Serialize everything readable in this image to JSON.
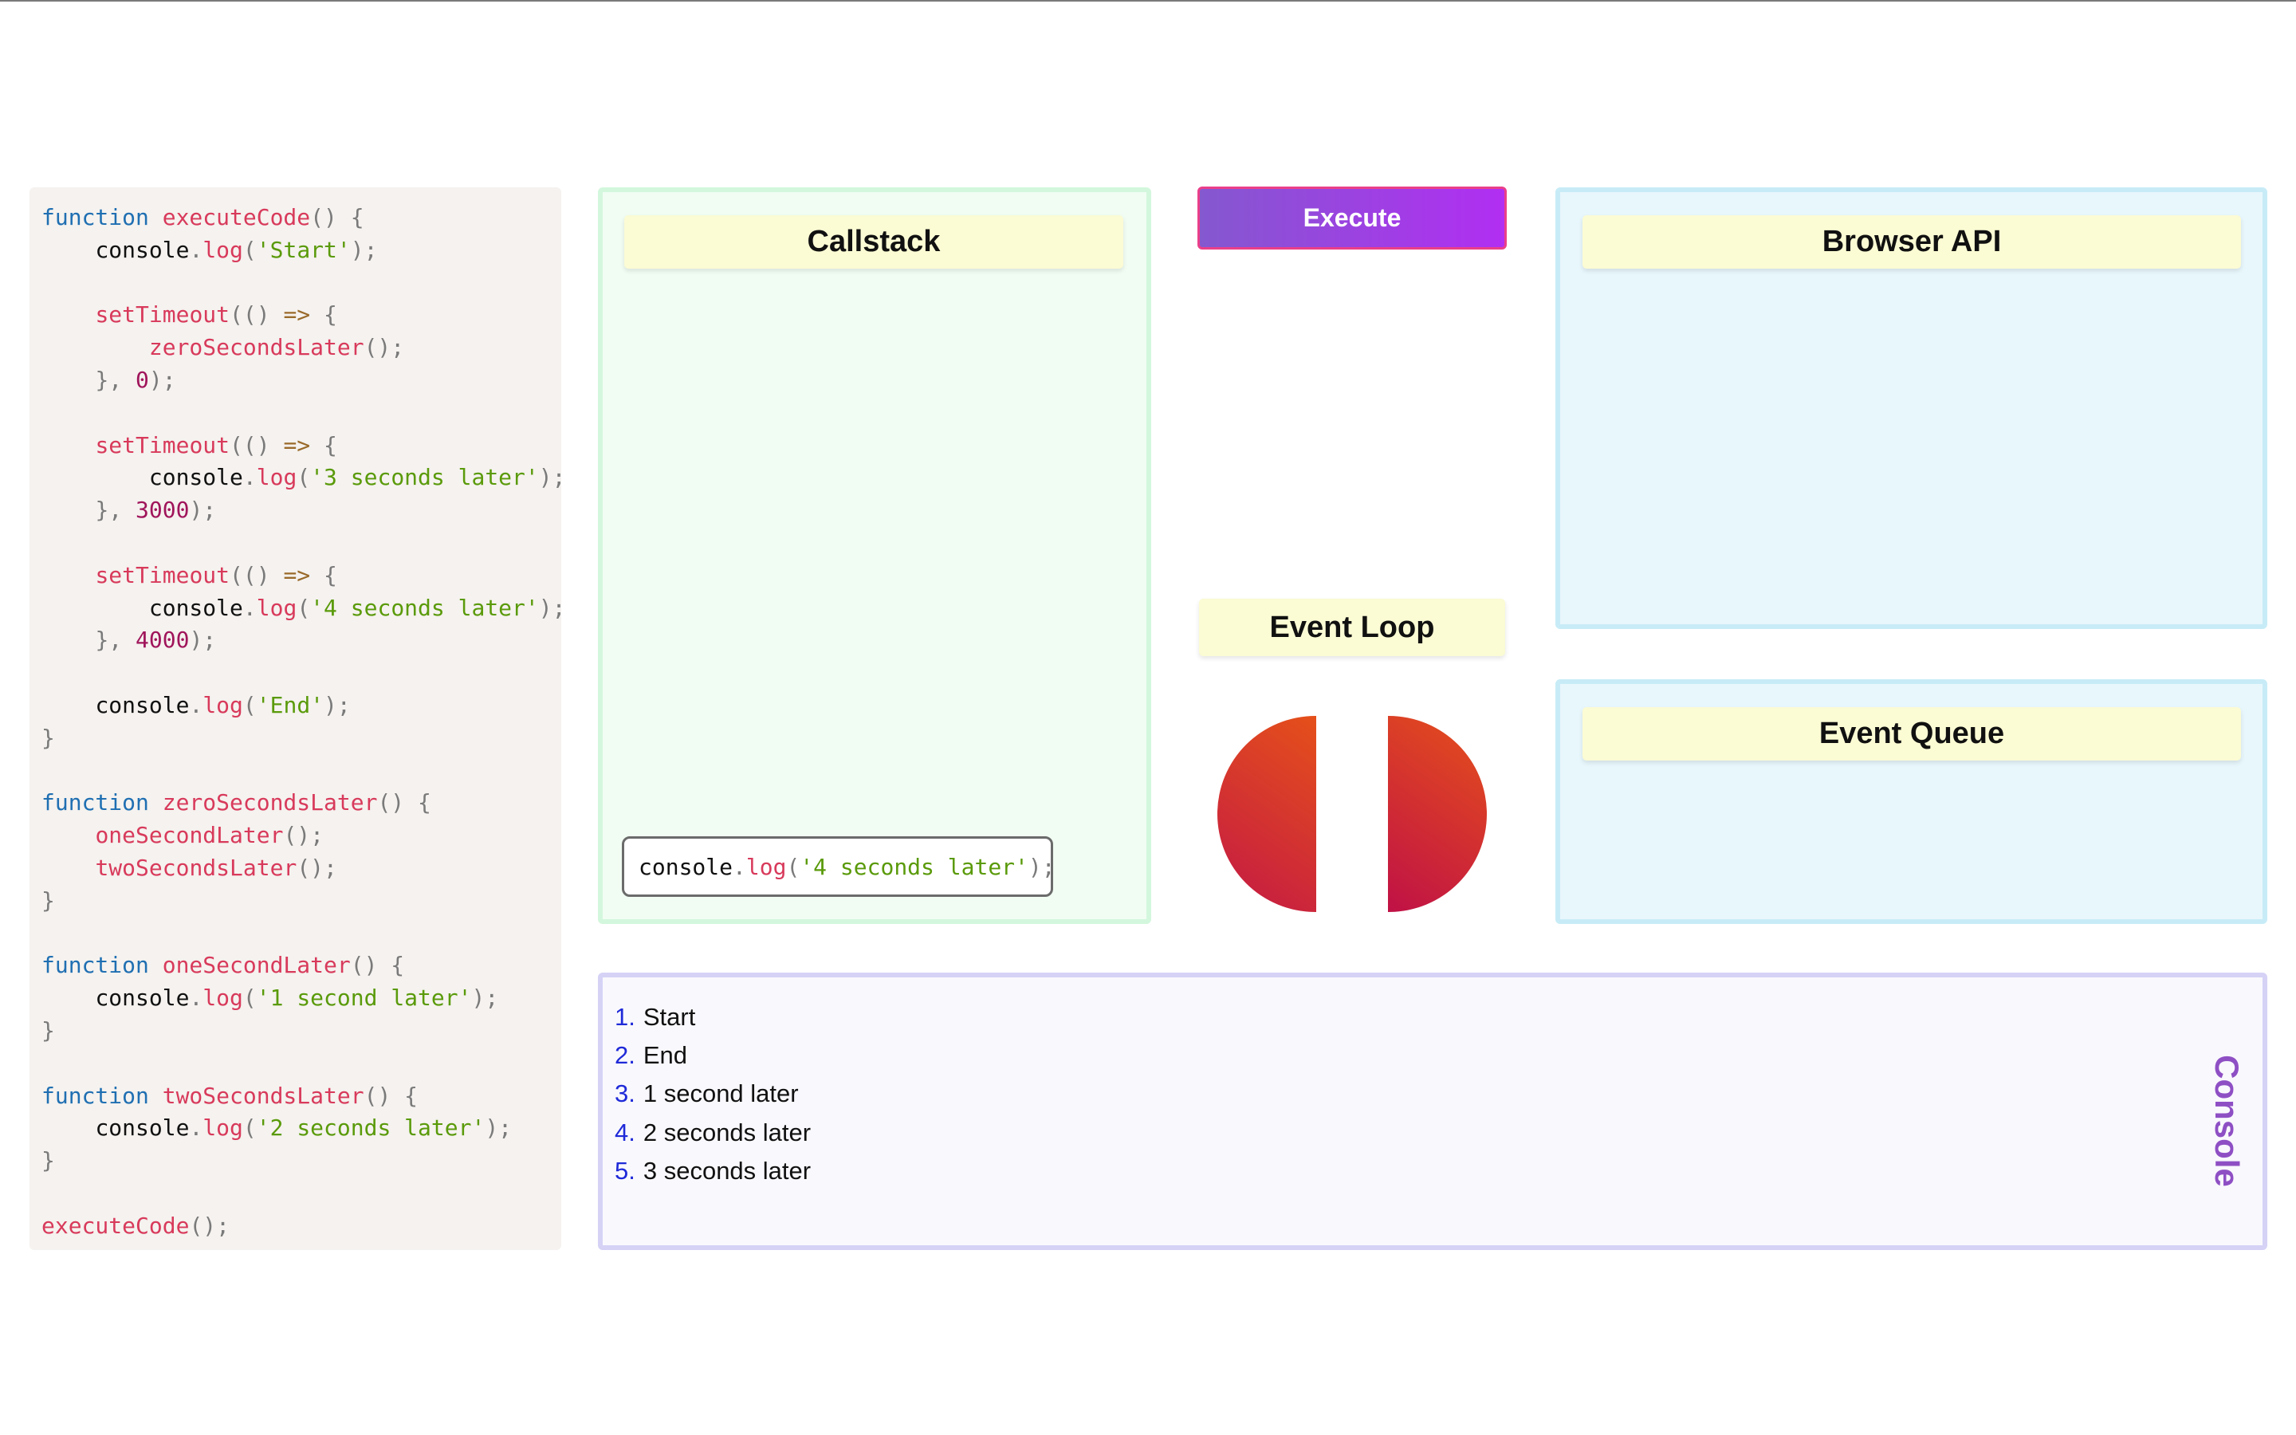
{
  "code_lines": [
    [
      {
        "t": "function",
        "c": "kw"
      },
      {
        "t": " "
      },
      {
        "t": "executeCode",
        "c": "fn"
      },
      {
        "t": "() {",
        "c": "pn"
      }
    ],
    [
      {
        "t": "    "
      },
      {
        "t": "console",
        "c": "id"
      },
      {
        "t": ".",
        "c": "pn"
      },
      {
        "t": "log",
        "c": "fn"
      },
      {
        "t": "(",
        "c": "pn"
      },
      {
        "t": "'Start'",
        "c": "str"
      },
      {
        "t": ");",
        "c": "pn"
      }
    ],
    [],
    [
      {
        "t": "    "
      },
      {
        "t": "setTimeout",
        "c": "fn"
      },
      {
        "t": "(() ",
        "c": "pn"
      },
      {
        "t": "=>",
        "c": "op"
      },
      {
        "t": " {",
        "c": "pn"
      }
    ],
    [
      {
        "t": "        "
      },
      {
        "t": "zeroSecondsLater",
        "c": "fn"
      },
      {
        "t": "();",
        "c": "pn"
      }
    ],
    [
      {
        "t": "    "
      },
      {
        "t": "}, ",
        "c": "pn"
      },
      {
        "t": "0",
        "c": "num"
      },
      {
        "t": ");",
        "c": "pn"
      }
    ],
    [],
    [
      {
        "t": "    "
      },
      {
        "t": "setTimeout",
        "c": "fn"
      },
      {
        "t": "(() ",
        "c": "pn"
      },
      {
        "t": "=>",
        "c": "op"
      },
      {
        "t": " {",
        "c": "pn"
      }
    ],
    [
      {
        "t": "        "
      },
      {
        "t": "console",
        "c": "id"
      },
      {
        "t": ".",
        "c": "pn"
      },
      {
        "t": "log",
        "c": "fn"
      },
      {
        "t": "(",
        "c": "pn"
      },
      {
        "t": "'3 seconds later'",
        "c": "str"
      },
      {
        "t": ");",
        "c": "pn"
      }
    ],
    [
      {
        "t": "    "
      },
      {
        "t": "}, ",
        "c": "pn"
      },
      {
        "t": "3000",
        "c": "num"
      },
      {
        "t": ");",
        "c": "pn"
      }
    ],
    [],
    [
      {
        "t": "    "
      },
      {
        "t": "setTimeout",
        "c": "fn"
      },
      {
        "t": "(() ",
        "c": "pn"
      },
      {
        "t": "=>",
        "c": "op"
      },
      {
        "t": " {",
        "c": "pn"
      }
    ],
    [
      {
        "t": "        "
      },
      {
        "t": "console",
        "c": "id"
      },
      {
        "t": ".",
        "c": "pn"
      },
      {
        "t": "log",
        "c": "fn"
      },
      {
        "t": "(",
        "c": "pn"
      },
      {
        "t": "'4 seconds later'",
        "c": "str"
      },
      {
        "t": ");",
        "c": "pn"
      }
    ],
    [
      {
        "t": "    "
      },
      {
        "t": "}, ",
        "c": "pn"
      },
      {
        "t": "4000",
        "c": "num"
      },
      {
        "t": ");",
        "c": "pn"
      }
    ],
    [],
    [
      {
        "t": "    "
      },
      {
        "t": "console",
        "c": "id"
      },
      {
        "t": ".",
        "c": "pn"
      },
      {
        "t": "log",
        "c": "fn"
      },
      {
        "t": "(",
        "c": "pn"
      },
      {
        "t": "'End'",
        "c": "str"
      },
      {
        "t": ");",
        "c": "pn"
      }
    ],
    [
      {
        "t": "}",
        "c": "pn"
      }
    ],
    [],
    [
      {
        "t": "function",
        "c": "kw"
      },
      {
        "t": " "
      },
      {
        "t": "zeroSecondsLater",
        "c": "fn"
      },
      {
        "t": "() {",
        "c": "pn"
      }
    ],
    [
      {
        "t": "    "
      },
      {
        "t": "oneSecondLater",
        "c": "fn"
      },
      {
        "t": "();",
        "c": "pn"
      }
    ],
    [
      {
        "t": "    "
      },
      {
        "t": "twoSecondsLater",
        "c": "fn"
      },
      {
        "t": "();",
        "c": "pn"
      }
    ],
    [
      {
        "t": "}",
        "c": "pn"
      }
    ],
    [],
    [
      {
        "t": "function",
        "c": "kw"
      },
      {
        "t": " "
      },
      {
        "t": "oneSecondLater",
        "c": "fn"
      },
      {
        "t": "() {",
        "c": "pn"
      }
    ],
    [
      {
        "t": "    "
      },
      {
        "t": "console",
        "c": "id"
      },
      {
        "t": ".",
        "c": "pn"
      },
      {
        "t": "log",
        "c": "fn"
      },
      {
        "t": "(",
        "c": "pn"
      },
      {
        "t": "'1 second later'",
        "c": "str"
      },
      {
        "t": ");",
        "c": "pn"
      }
    ],
    [
      {
        "t": "}",
        "c": "pn"
      }
    ],
    [],
    [
      {
        "t": "function",
        "c": "kw"
      },
      {
        "t": " "
      },
      {
        "t": "twoSecondsLater",
        "c": "fn"
      },
      {
        "t": "() {",
        "c": "pn"
      }
    ],
    [
      {
        "t": "    "
      },
      {
        "t": "console",
        "c": "id"
      },
      {
        "t": ".",
        "c": "pn"
      },
      {
        "t": "log",
        "c": "fn"
      },
      {
        "t": "(",
        "c": "pn"
      },
      {
        "t": "'2 seconds later'",
        "c": "str"
      },
      {
        "t": ");",
        "c": "pn"
      }
    ],
    [
      {
        "t": "}",
        "c": "pn"
      }
    ],
    [],
    [
      {
        "t": "executeCode",
        "c": "fn"
      },
      {
        "t": "();",
        "c": "pn"
      }
    ]
  ],
  "callstack": {
    "title": "Callstack",
    "frames": [
      [
        {
          "t": "console",
          "c": "id"
        },
        {
          "t": ".",
          "c": "pn"
        },
        {
          "t": "log",
          "c": "fn"
        },
        {
          "t": "(",
          "c": "pn"
        },
        {
          "t": "'4 seconds later'",
          "c": "str"
        },
        {
          "t": ");",
          "c": "pn"
        }
      ]
    ]
  },
  "execute_button": {
    "label": "Execute"
  },
  "event_loop": {
    "title": "Event Loop"
  },
  "browser_api": {
    "title": "Browser API"
  },
  "event_queue": {
    "title": "Event Queue"
  },
  "console": {
    "label": "Console",
    "entries": [
      {
        "num": "1.",
        "text": "Start"
      },
      {
        "num": "2.",
        "text": "End"
      },
      {
        "num": "3.",
        "text": "1 second later"
      },
      {
        "num": "4.",
        "text": "2 seconds later"
      },
      {
        "num": "5.",
        "text": "3 seconds later"
      }
    ]
  },
  "colors": {
    "code_keyword": "#1f6fb2",
    "code_function": "#d83a5b",
    "code_string": "#5a9a0a",
    "code_number": "#a0155b",
    "console_number": "#1f2ad8",
    "console_label": "#8e4fc4",
    "execute_gradient_start": "#8458cf",
    "execute_gradient_end": "#b12ef2"
  }
}
